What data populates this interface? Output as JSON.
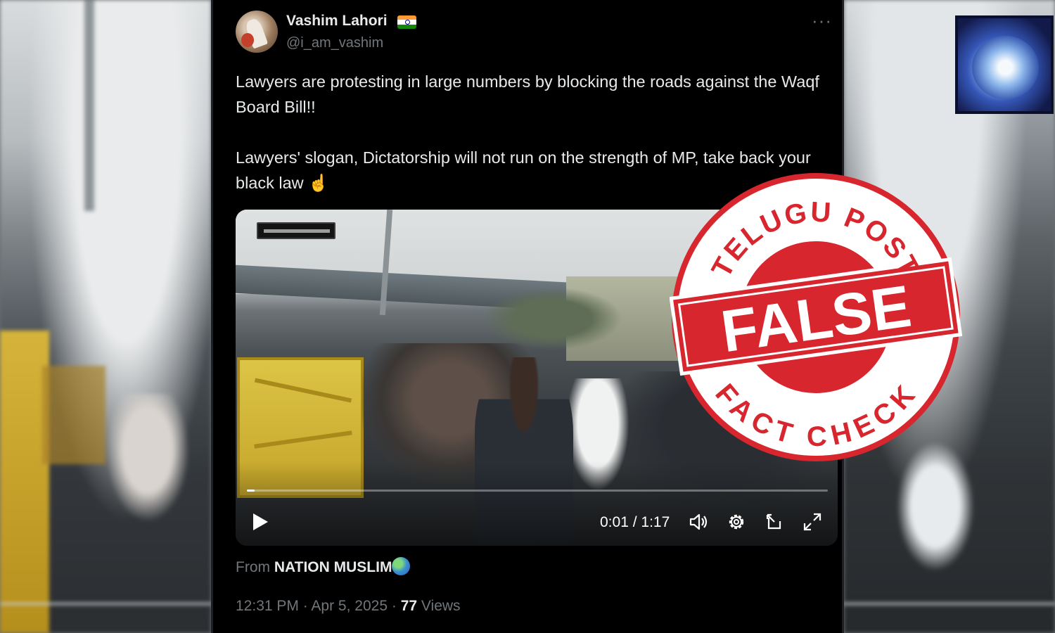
{
  "tweet": {
    "display_name": "Vashim Lahori",
    "flag_icon": "india-flag-icon",
    "handle": "@i_am_vashim",
    "more_icon": "···",
    "paragraphs": [
      "Lawyers are protesting in large numbers by blocking the roads against the Waqf Board Bill!!",
      "Lawyers' slogan, Dictatorship will not run on the strength of MP, take back your black law ☝️"
    ],
    "video": {
      "current_time": "0:01",
      "separator": "/",
      "duration": "1:17",
      "progress": 0.013,
      "controls": [
        "play-icon",
        "volume-icon",
        "settings-icon",
        "popout-icon",
        "fullscreen-icon"
      ]
    },
    "from_label": "From",
    "source_name": "NATION MUSLIM",
    "time": "12:31 PM",
    "date": "Apr 5, 2025",
    "dot": "·",
    "views_count": "77",
    "views_label": "Views"
  },
  "stamp": {
    "top_text": "TELUGU POST",
    "center_text": "FALSE",
    "bottom_text": "FACT CHECK",
    "color": "#d8262f"
  },
  "colors": {
    "tweet_bg": "#000000",
    "primary_text": "#e7e9ea",
    "secondary_text": "#71767b"
  }
}
